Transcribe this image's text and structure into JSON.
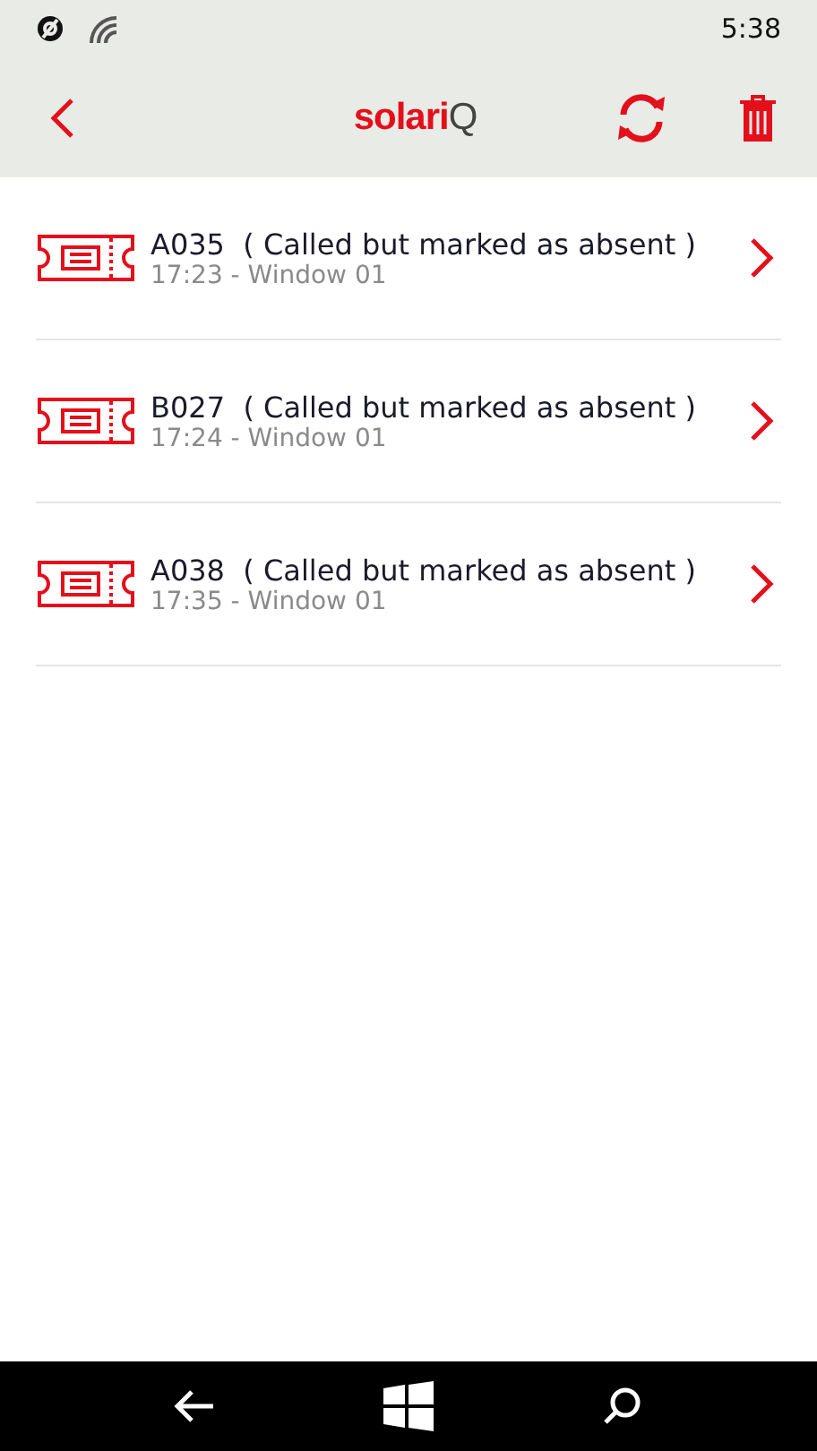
{
  "status_bar": {
    "time": "5:38"
  },
  "header": {
    "logo": {
      "main": "solari",
      "suffix": "Q"
    }
  },
  "tickets": [
    {
      "number": "A035",
      "status": "( Called but marked as absent )",
      "detail": "17:23 - Window 01"
    },
    {
      "number": "B027",
      "status": "( Called but marked as absent )",
      "detail": "17:24 - Window 01"
    },
    {
      "number": "A038",
      "status": "( Called but marked as absent )",
      "detail": "17:35 - Window 01"
    }
  ]
}
